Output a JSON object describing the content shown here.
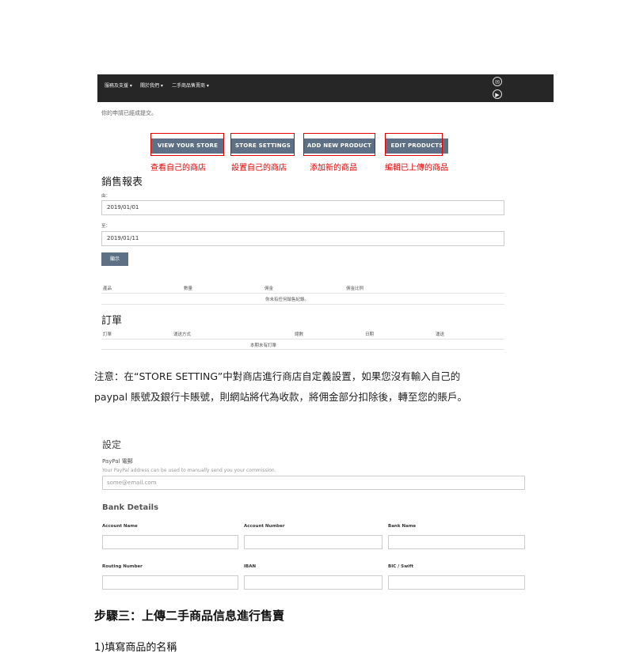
{
  "nav": {
    "items": [
      "服務及支援 ▾",
      "關於我們 ▾",
      "二手商品售賣商 ▾"
    ],
    "icons": [
      "mail-icon",
      "youtube-icon"
    ]
  },
  "notice": "你的申請已經成提交。",
  "store_buttons": [
    {
      "label": "VIEW YOUR STORE",
      "caption": "查看自己的商店"
    },
    {
      "label": "STORE SETTINGS",
      "caption": "設置自己的商店"
    },
    {
      "label": "ADD NEW PRODUCT",
      "caption": "添加新的商品"
    },
    {
      "label": "EDIT PRODUCTS",
      "caption": "編輯已上傳的商品"
    }
  ],
  "sales": {
    "title": "銷售報表",
    "from_label": "由：",
    "from_value": "2019/01/01",
    "to_label": "至：",
    "to_value": "2019/01/11",
    "show_button": "顯示",
    "columns": [
      "產品",
      "數量",
      "佣金",
      "佣金比例"
    ],
    "empty": "你未有任何銷售紀錄。"
  },
  "orders": {
    "title": "訂單",
    "columns": [
      "訂單",
      "運送方式",
      "總數",
      "日期",
      "運送"
    ],
    "empty": "本期未有訂單"
  },
  "note": {
    "line1": "注意：在“STORE SETTING”中對商店進行商店自定義設置，如果您沒有輸入自己的",
    "line2": "paypal 賬號及銀行卡賬號，則網站將代為收款，將佣金部分扣除後，轉至您的賬戶。"
  },
  "settings": {
    "title": "設定",
    "paypal_label": "PayPal 電郵",
    "paypal_hint": "Your PayPal address can be used to manually send you your commission.",
    "paypal_placeholder": "some@email.com",
    "bank_title": "Bank Details",
    "row1": [
      "Account Name",
      "Account Number",
      "Bank Name"
    ],
    "row2": [
      "Routing Number",
      "IBAN",
      "BIC / Swift"
    ]
  },
  "step": {
    "title": "步驟三：上傳二手商品信息進行售賣",
    "sub": "1)填寫商品的名稱"
  }
}
